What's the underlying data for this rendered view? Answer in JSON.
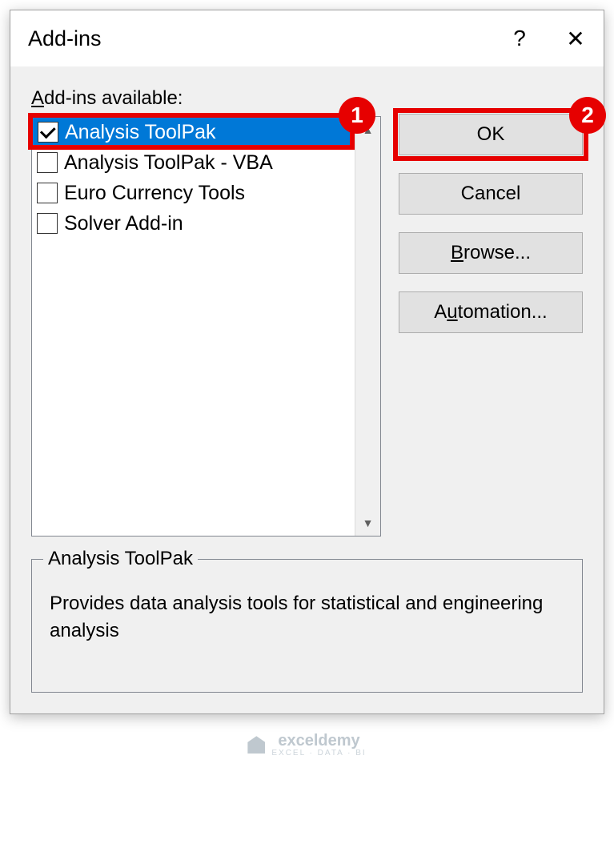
{
  "dialog": {
    "title": "Add-ins",
    "label": "Add-ins available:",
    "label_underline_index": 0
  },
  "addins": [
    {
      "label": "Analysis ToolPak",
      "checked": true,
      "selected": true
    },
    {
      "label": "Analysis ToolPak - VBA",
      "checked": false,
      "selected": false
    },
    {
      "label": "Euro Currency Tools",
      "checked": false,
      "selected": false
    },
    {
      "label": "Solver Add-in",
      "checked": false,
      "selected": false
    }
  ],
  "buttons": {
    "ok": "OK",
    "cancel": "Cancel",
    "browse": "Browse...",
    "automation": "Automation..."
  },
  "description": {
    "title": "Analysis ToolPak",
    "text": "Provides data analysis tools for statistical and engineering analysis"
  },
  "callouts": {
    "badge1": "1",
    "badge2": "2"
  },
  "watermark": {
    "text": "exceldemy",
    "sub": "EXCEL · DATA · BI"
  }
}
